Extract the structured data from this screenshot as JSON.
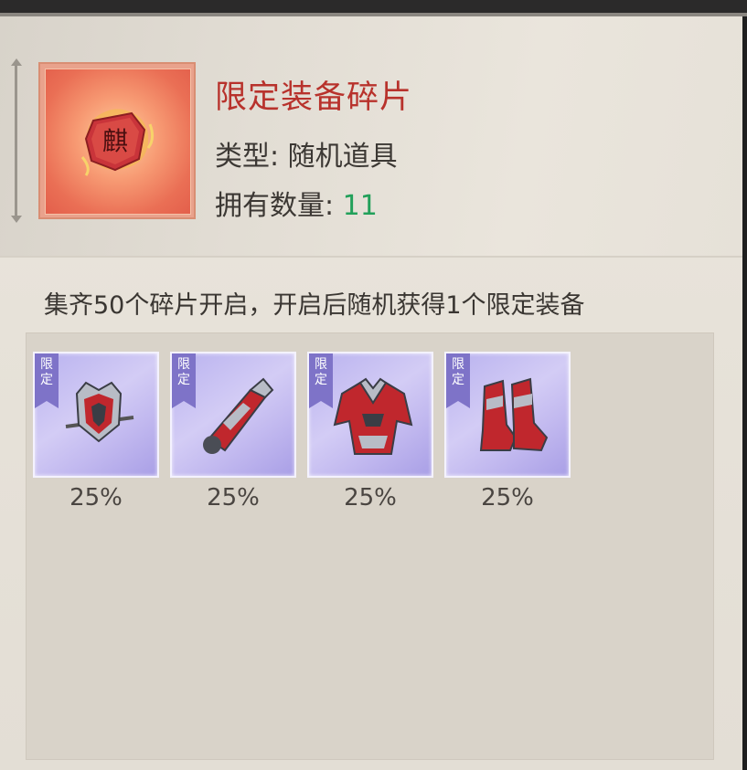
{
  "item": {
    "name": "限定装备碎片",
    "type_label": "类型: ",
    "type_value": "随机道具",
    "count_label": "拥有数量: ",
    "count_value": "11",
    "icon": "fragment-qi-icon",
    "icon_character": "麒"
  },
  "description": "集齐50个碎片开启，开启后随机获得1个限定装备",
  "rewards": [
    {
      "tag": "限定",
      "icon": "helmet-icon",
      "chance": "25%"
    },
    {
      "tag": "限定",
      "icon": "gauntlet-icon",
      "chance": "25%"
    },
    {
      "tag": "限定",
      "icon": "armor-icon",
      "chance": "25%"
    },
    {
      "tag": "限定",
      "icon": "boots-icon",
      "chance": "25%"
    }
  ],
  "colors": {
    "name": "#b8322c",
    "count": "#22a05a",
    "reward_bg": "#c1b8ef",
    "equipment_red": "#c0272d"
  }
}
